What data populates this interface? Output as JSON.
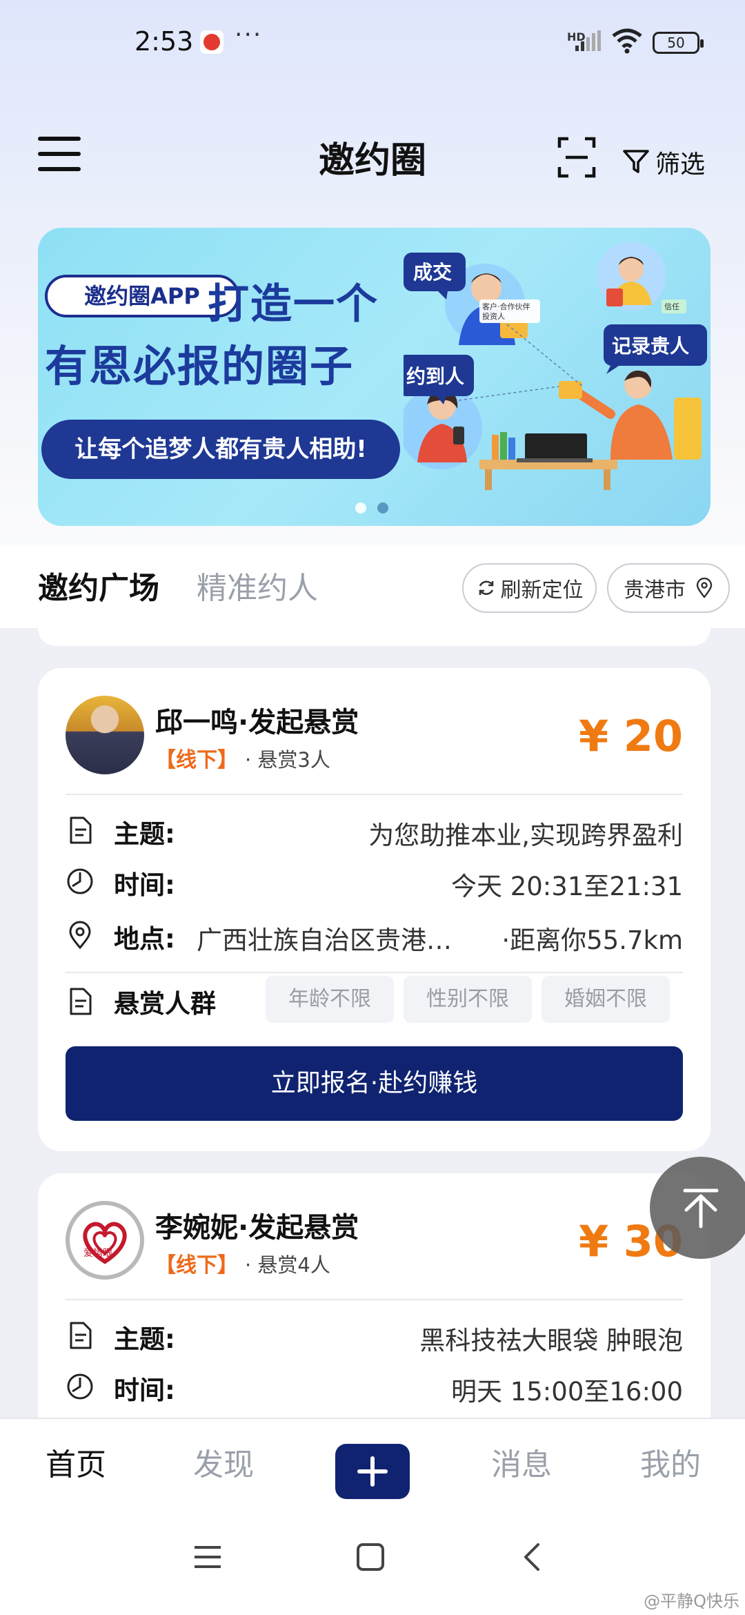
{
  "status_bar": {
    "time": "2:53",
    "dots": "···",
    "network": "HD",
    "battery": "50"
  },
  "header": {
    "title": "邀约圈",
    "filter_label": "筛选"
  },
  "banner": {
    "badge": "邀约圈APP",
    "title_line1": "打造一个",
    "title_line2": "有恩必报的圈子",
    "pill": "让每个追梦人都有贵人相助!",
    "bubble_deal": "成交",
    "bubble_record": "记录贵人",
    "bubble_meet": "约到人",
    "note_customer": "客户·合作伙伴",
    "note_investor": "投资人",
    "note_trust": "信任"
  },
  "tabs": {
    "active": "邀约广场",
    "inactive": "精准约人",
    "refresh_label": "刷新定位",
    "city_label": "贵港市"
  },
  "cards": [
    {
      "name": "邱一鸣·发起悬赏",
      "tag": "【线下】",
      "count": "· 悬赏3人",
      "price": "¥ 20",
      "topic_label": "主题:",
      "topic": "为您助推本业,实现跨界盈利",
      "time_label": "时间:",
      "time": "今天 20:31至21:31",
      "place_label": "地点:",
      "address": "广西壮族自治区贵港市港北区",
      "distance": "·距离你55.7km",
      "crowd_label": "悬赏人群",
      "chips": [
        "年龄不限",
        "性别不限",
        "婚姻不限"
      ],
      "cta": "立即报名·赴约赚钱"
    },
    {
      "name": "李婉妮·发起悬赏",
      "tag": "【线下】",
      "count": "· 悬赏4人",
      "price": "¥ 30",
      "topic_label": "主题:",
      "topic": "黑科技祛大眼袋 肿眼泡",
      "time_label": "时间:",
      "time": "明天 15:00至16:00",
      "logo_text": "爱惜眼"
    }
  ],
  "bottom_nav": {
    "home": "首页",
    "discover": "发现",
    "messages": "消息",
    "mine": "我的"
  },
  "watermark": "@平静Q快乐",
  "colors": {
    "primary": "#0f2370",
    "price": "#f07a12",
    "tag": "#ee6a1b",
    "banner_text": "#1c3b9c"
  }
}
